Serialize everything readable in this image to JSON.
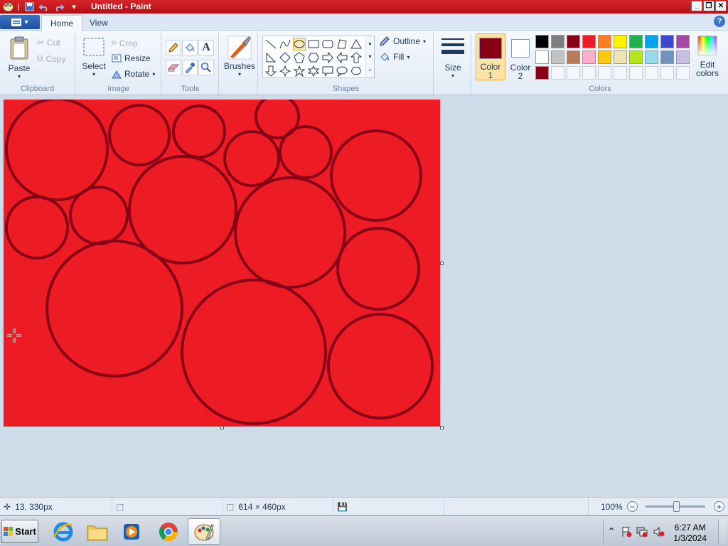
{
  "window": {
    "title": "Untitled - Paint"
  },
  "tabs": [
    {
      "label": "Home"
    },
    {
      "label": "View"
    }
  ],
  "ribbon": {
    "clipboard": {
      "group_label": "Clipboard",
      "paste": "Paste",
      "cut": "Cut",
      "copy": "Copy"
    },
    "image": {
      "group_label": "Image",
      "select": "Select",
      "crop": "Crop",
      "resize": "Resize",
      "rotate": "Rotate"
    },
    "tools": {
      "group_label": "Tools"
    },
    "brushes": {
      "label": "Brushes"
    },
    "shapes": {
      "group_label": "Shapes",
      "outline": "Outline",
      "fill": "Fill"
    },
    "size": {
      "label": "Size"
    },
    "colors": {
      "group_label": "Colors",
      "color1_label_line1": "Color",
      "color1_label_line2": "1",
      "color2_label_line1": "Color",
      "color2_label_line2": "2",
      "edit_label_line1": "Edit",
      "edit_label_line2": "colors",
      "color1": "#880015",
      "color2": "#ffffff",
      "palette_row1": [
        "#000000",
        "#7f7f7f",
        "#880015",
        "#ed1c24",
        "#ff7f27",
        "#fff200",
        "#22b14c",
        "#00a2e8",
        "#3f48cc",
        "#a349a4"
      ],
      "palette_row2": [
        "#ffffff",
        "#c3c3c3",
        "#b97a57",
        "#ffaec9",
        "#ffc90e",
        "#efe4b0",
        "#b5e61d",
        "#99d9ea",
        "#7092be",
        "#c8bfe7"
      ],
      "palette_row3": [
        "#880015",
        "",
        "",
        "",
        "",
        "",
        "",
        "",
        "",
        ""
      ]
    }
  },
  "canvas": {
    "fill_color": "#ed1c24",
    "outline_color": "#880015"
  },
  "statusbar": {
    "cursor_pos": "13, 330px",
    "canvas_size": "614 × 460px",
    "zoom": "100%"
  },
  "taskbar": {
    "start_label": "Start",
    "apps": [
      "internet-explorer",
      "file-explorer",
      "media-player",
      "chrome",
      "paint"
    ],
    "time": "6:27 AM",
    "date": "1/3/2024"
  }
}
